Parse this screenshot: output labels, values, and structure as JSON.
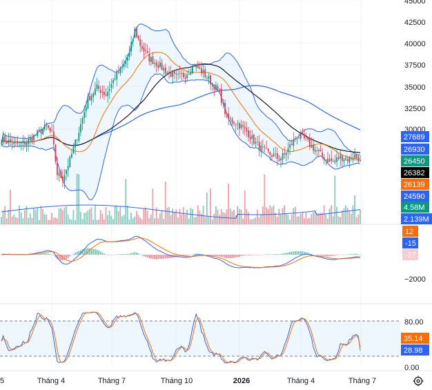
{
  "colors": {
    "up": "#089981",
    "down": "#f23645",
    "bb_band": "#2962ff",
    "bb_basis": "#ff6d00",
    "ma_long": "#2962ff",
    "ma_black": "#131722",
    "macd": "#2962ff",
    "signal": "#ff6d00",
    "stoch_k": "#2962ff",
    "stoch_d": "#ff6d00",
    "grid": "#f0f3fa"
  },
  "price_axis": {
    "ticks": [
      "45000",
      "42500",
      "40000",
      "37500",
      "35000",
      "32500",
      "30000"
    ]
  },
  "badges": [
    {
      "label": "27689",
      "color": "#2962ff",
      "text_color": "#ffffff"
    },
    {
      "label": "26930",
      "color": "#2962ff",
      "text_color": "#ffffff"
    },
    {
      "label": "26450",
      "color": "#089981",
      "text_color": "#ffffff"
    },
    {
      "label": "26382",
      "color": "#000000",
      "text_color": "#ffffff"
    },
    {
      "label": "26139",
      "color": "#ff6d00",
      "text_color": "#ffffff"
    },
    {
      "label": "24590",
      "color": "#2962ff",
      "text_color": "#ffffff"
    },
    {
      "label": "4.58M",
      "color": "#089981",
      "text_color": "#ffffff"
    },
    {
      "label": "2.139M",
      "color": "#2962ff",
      "text_color": "#ffffff"
    }
  ],
  "macd_badges": [
    {
      "label": "12",
      "color": "#ff6d00",
      "text_color": "#ffffff"
    },
    {
      "label": "-15",
      "color": "#2962ff",
      "text_color": "#ffffff"
    },
    {
      "label": "-27",
      "color": "#fccbcd",
      "text_color": "#131722"
    }
  ],
  "macd_axis": {
    "ticks": [
      "−2000"
    ]
  },
  "stoch_axis": {
    "ticks": [
      "80.00",
      "0.00"
    ]
  },
  "stoch_badges": [
    {
      "label": "35.14",
      "color": "#ff6d00",
      "text_color": "#ffffff"
    },
    {
      "label": "28.98",
      "color": "#2962ff",
      "text_color": "#ffffff"
    }
  ],
  "time_axis": {
    "labels": [
      {
        "text": "5",
        "bold": false
      },
      {
        "text": "Tháng 4",
        "bold": false
      },
      {
        "text": "Tháng 7",
        "bold": false
      },
      {
        "text": "Tháng 10",
        "bold": false
      },
      {
        "text": "2026",
        "bold": true
      },
      {
        "text": "Tháng 4",
        "bold": false
      },
      {
        "text": "Tháng 7",
        "bold": false
      }
    ]
  },
  "chart_data": {
    "type": "candlestick",
    "symbol_last": 26382,
    "price_range": [
      24000,
      45000
    ],
    "x_labels": [
      "Tháng 4",
      "Tháng 7",
      "Tháng 10",
      "2026",
      "Tháng 4",
      "Tháng 7"
    ],
    "close_path": [
      {
        "t": 0,
        "close": 28800
      },
      {
        "t": 8,
        "close": 28200
      },
      {
        "t": 14,
        "close": 28500
      },
      {
        "t": 20,
        "close": 29500
      },
      {
        "t": 25,
        "close": 30300
      },
      {
        "t": 28,
        "close": 29400
      },
      {
        "t": 31,
        "close": 24800
      },
      {
        "t": 34,
        "close": 24300
      },
      {
        "t": 38,
        "close": 26400
      },
      {
        "t": 43,
        "close": 29800
      },
      {
        "t": 48,
        "close": 33500
      },
      {
        "t": 53,
        "close": 34800
      },
      {
        "t": 58,
        "close": 34000
      },
      {
        "t": 63,
        "close": 36000
      },
      {
        "t": 68,
        "close": 37400
      },
      {
        "t": 71,
        "close": 38800
      },
      {
        "t": 74,
        "close": 41500
      },
      {
        "t": 77,
        "close": 39800
      },
      {
        "t": 82,
        "close": 38200
      },
      {
        "t": 87,
        "close": 37500
      },
      {
        "t": 92,
        "close": 36600
      },
      {
        "t": 97,
        "close": 36000
      },
      {
        "t": 102,
        "close": 36300
      },
      {
        "t": 107,
        "close": 37500
      },
      {
        "t": 112,
        "close": 36500
      },
      {
        "t": 117,
        "close": 35300
      },
      {
        "t": 121,
        "close": 34200
      },
      {
        "t": 125,
        "close": 31300
      },
      {
        "t": 129,
        "close": 30900
      },
      {
        "t": 133,
        "close": 30300
      },
      {
        "t": 137,
        "close": 29500
      },
      {
        "t": 141,
        "close": 28300
      },
      {
        "t": 146,
        "close": 27400
      },
      {
        "t": 150,
        "close": 27000
      },
      {
        "t": 154,
        "close": 26500
      },
      {
        "t": 157,
        "close": 27000
      },
      {
        "t": 160,
        "close": 28000
      },
      {
        "t": 164,
        "close": 29200
      },
      {
        "t": 168,
        "close": 28800
      },
      {
        "t": 172,
        "close": 28000
      },
      {
        "t": 176,
        "close": 27200
      },
      {
        "t": 180,
        "close": 26500
      },
      {
        "t": 184,
        "close": 26200
      },
      {
        "t": 188,
        "close": 26800
      },
      {
        "t": 192,
        "close": 26500
      },
      {
        "t": 196,
        "close": 26900
      },
      {
        "t": 199,
        "close": 26400
      }
    ],
    "volume_last": "4.58M",
    "volume_ma": "2.139M",
    "macd": {
      "macd": 12,
      "signal": -15,
      "histogram": -27
    },
    "stochastic": {
      "k": 35.14,
      "d": 28.98,
      "upper": 80,
      "lower": 20,
      "range": [
        0,
        100
      ]
    }
  }
}
